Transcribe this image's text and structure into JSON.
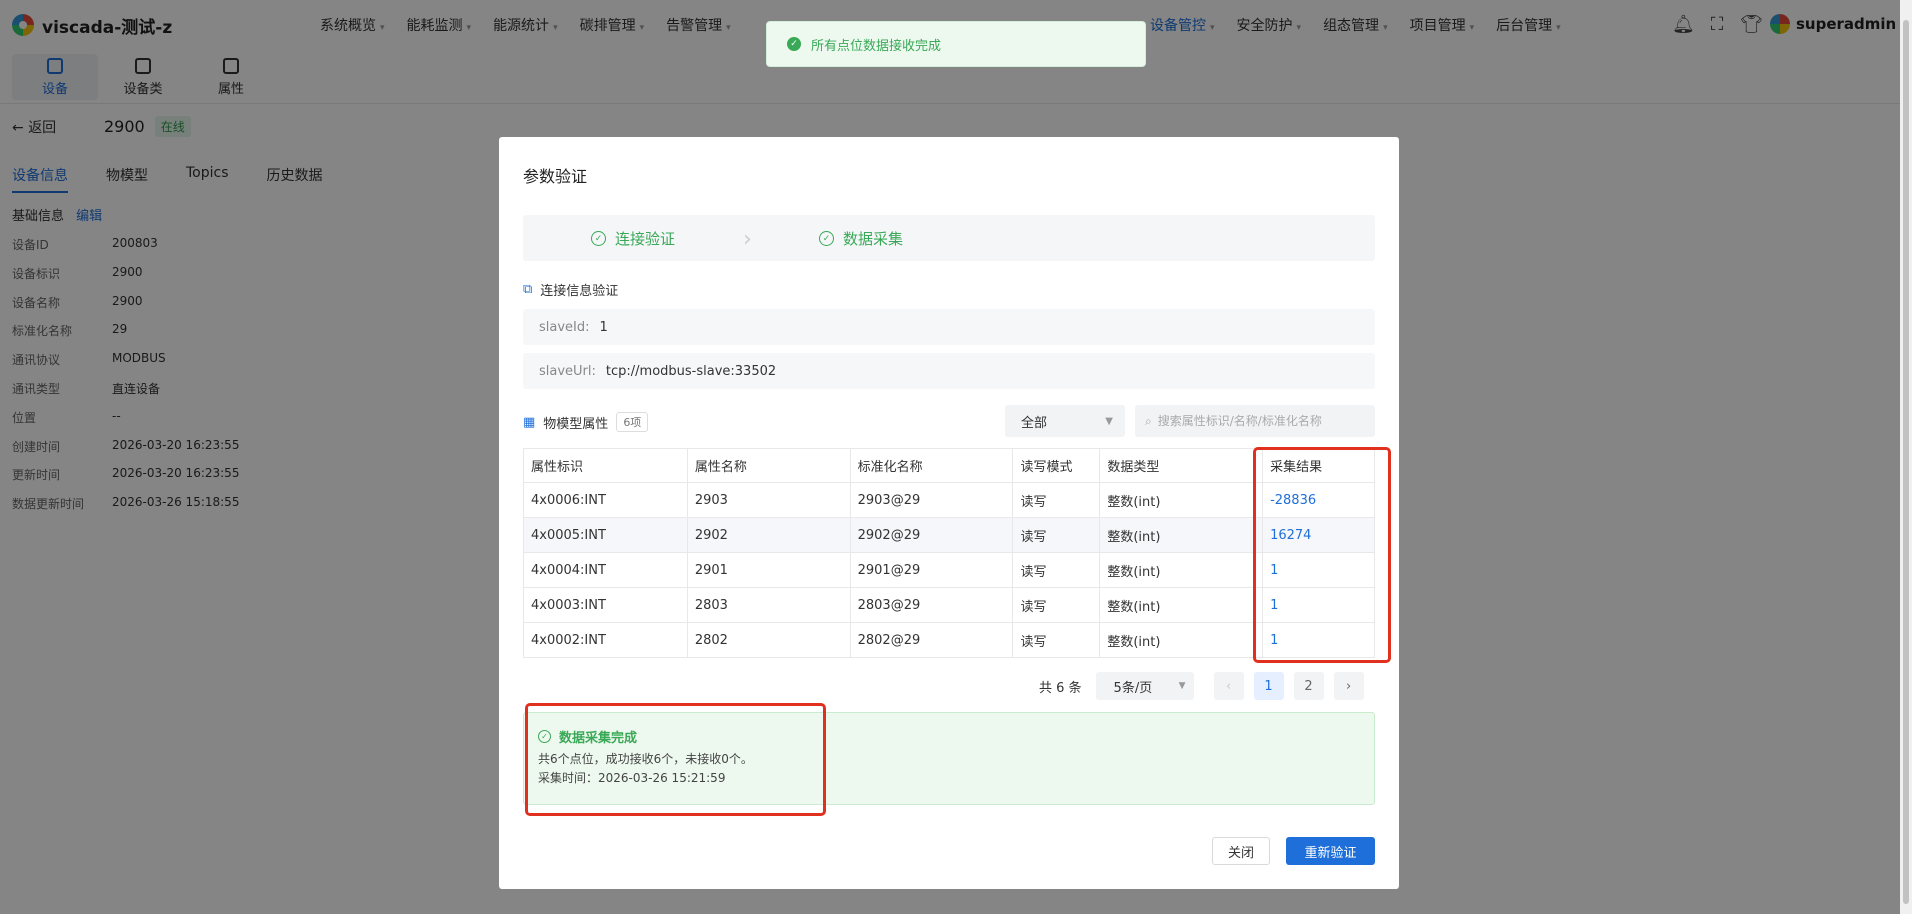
{
  "app": {
    "title": "viscada-测试-z"
  },
  "nav": {
    "left": [
      "系统概览",
      "能耗监测",
      "能源统计",
      "碳排管理",
      "告警管理"
    ],
    "right": [
      "设备管控",
      "安全防护",
      "组态管理",
      "项目管理",
      "后台管理"
    ],
    "active": "设备管控"
  },
  "header": {
    "username": "superadmin"
  },
  "subnav": {
    "items": [
      "设备",
      "设备类",
      "属性"
    ],
    "active": "设备"
  },
  "toast": {
    "message": "所有点位数据接收完成"
  },
  "page": {
    "back_label": "返回",
    "device_name": "2900",
    "status": "在线",
    "tabs": [
      "设备信息",
      "物模型",
      "Topics",
      "历史数据"
    ],
    "active_tab": "设备信息",
    "section_title": "基础信息",
    "edit_label": "编辑",
    "fields": [
      {
        "label": "设备ID",
        "value": "200803"
      },
      {
        "label": "设备标识",
        "value": "2900"
      },
      {
        "label": "设备名称",
        "value": "2900"
      },
      {
        "label": "标准化名称",
        "value": "29"
      },
      {
        "label": "通讯协议",
        "value": "MODBUS"
      },
      {
        "label": "通讯类型",
        "value": "直连设备"
      },
      {
        "label": "位置",
        "value": "--"
      },
      {
        "label": "创建时间",
        "value": "2026-03-20 16:23:55"
      },
      {
        "label": "更新时间",
        "value": "2026-03-20 16:23:55"
      },
      {
        "label": "数据更新时间",
        "value": "2026-03-26 15:18:55"
      }
    ]
  },
  "modal": {
    "title": "参数验证",
    "steps": [
      "连接验证",
      "数据采集"
    ],
    "connection_title": "连接信息验证",
    "slave_id_label": "slaveId:",
    "slave_id": "1",
    "slave_url_label": "slaveUrl:",
    "slave_url": "tcp://modbus-slave:33502",
    "model_title": "物模型属性",
    "model_count": "6项",
    "filter_value": "全部",
    "search_placeholder": "搜索属性标识/名称/标准化名称",
    "table": {
      "headers": [
        "属性标识",
        "属性名称",
        "标准化名称",
        "读写模式",
        "数据类型",
        "采集结果"
      ],
      "rows": [
        [
          "4x0006:INT",
          "2903",
          "2903@29",
          "读写",
          "整数(int)",
          "-28836"
        ],
        [
          "4x0005:INT",
          "2902",
          "2902@29",
          "读写",
          "整数(int)",
          "16274"
        ],
        [
          "4x0004:INT",
          "2901",
          "2901@29",
          "读写",
          "整数(int)",
          "1"
        ],
        [
          "4x0003:INT",
          "2803",
          "2803@29",
          "读写",
          "整数(int)",
          "1"
        ],
        [
          "4x0002:INT",
          "2802",
          "2802@29",
          "读写",
          "整数(int)",
          "1"
        ]
      ]
    },
    "pagination": {
      "total": "共 6 条",
      "page_size": "5条/页",
      "pages": [
        "1",
        "2"
      ],
      "current": "1"
    },
    "result": {
      "title": "数据采集完成",
      "summary": "共6个点位，成功接收6个，未接收0个。",
      "time": "采集时间：2026-03-26 15:21:59"
    },
    "close_label": "关闭",
    "retry_label": "重新验证"
  },
  "colors": {
    "accent": "#1e6fd9",
    "success": "#3aa957",
    "highlight": "#e0301e"
  }
}
